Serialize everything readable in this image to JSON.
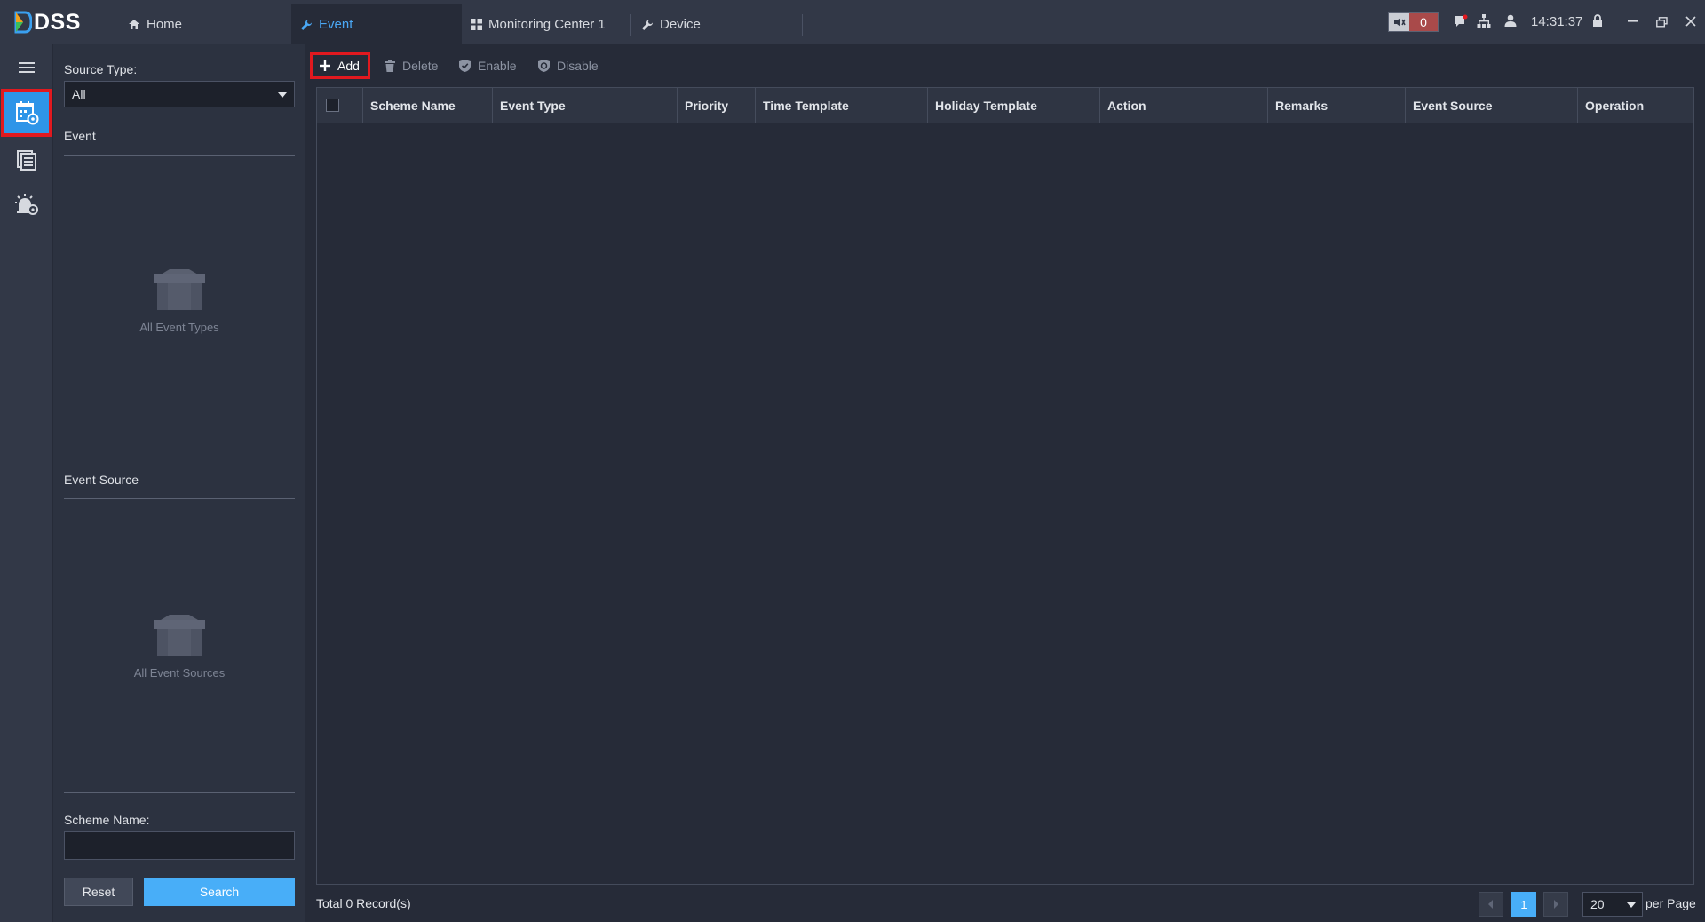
{
  "app": {
    "logo_text": "DSS"
  },
  "tabs": [
    {
      "label": "Home",
      "icon": "home-icon"
    },
    {
      "label": "Event",
      "icon": "wrench-icon",
      "active": true
    },
    {
      "label": "Monitoring Center 1",
      "icon": "grid-icon"
    },
    {
      "label": "Device",
      "icon": "wrench-icon"
    }
  ],
  "status": {
    "alarm_count": "0",
    "time": "14:31:37"
  },
  "filter": {
    "source_type_label": "Source Type:",
    "source_type_value": "All",
    "event_label": "Event",
    "event_empty": "All Event Types",
    "event_source_label": "Event Source",
    "event_source_empty": "All Event Sources",
    "scheme_name_label": "Scheme Name:",
    "scheme_name_value": "",
    "reset_label": "Reset",
    "search_label": "Search"
  },
  "toolbar": {
    "add_label": "Add",
    "delete_label": "Delete",
    "enable_label": "Enable",
    "disable_label": "Disable"
  },
  "table": {
    "columns": [
      "Scheme Name",
      "Event Type",
      "Priority",
      "Time Template",
      "Holiday Template",
      "Action",
      "Remarks",
      "Event Source",
      "Operation"
    ],
    "rows": []
  },
  "pagination": {
    "total_prefix": "Total",
    "total_count": "0",
    "total_suffix": "Record(s)",
    "current_page": "1",
    "page_size": "20",
    "per_page_label": "per Page"
  },
  "colors": {
    "accent": "#48aef8",
    "highlight": "#e1191f",
    "background": "#262b38"
  }
}
